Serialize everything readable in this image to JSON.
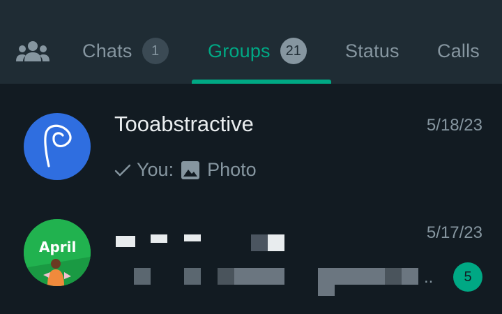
{
  "tabs": {
    "community_icon": "community-icon",
    "items": [
      {
        "label": "Chats",
        "badge": "1"
      },
      {
        "label": "Groups",
        "badge": "21"
      },
      {
        "label": "Status"
      },
      {
        "label": "Calls"
      }
    ],
    "active": "Groups"
  },
  "chats": [
    {
      "name": "Tooabstractive",
      "time": "5/18/23",
      "preview_prefix": "You:",
      "preview_icon": "photo-icon",
      "preview_text": "Photo",
      "status_icon": "single-check-icon",
      "avatar_icon": "tooabstractive-logo"
    },
    {
      "time": "5/17/23",
      "avatar_text": "April",
      "preview_ellipsis": "..",
      "unread_count": "5"
    }
  ],
  "colors": {
    "header_bg": "#1f2c34",
    "list_bg": "#121b22",
    "accent": "#00a884",
    "muted": "#8696a0",
    "primary_text": "#e9edef"
  }
}
